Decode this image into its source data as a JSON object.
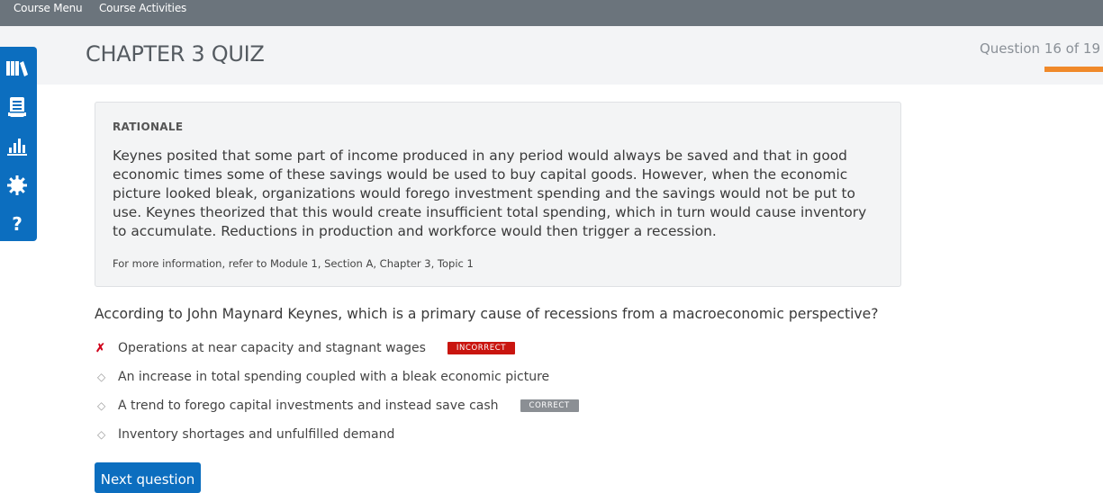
{
  "topbar": {
    "course_menu": "Course Menu",
    "course_activities": "Course Activities"
  },
  "header": {
    "title": "CHAPTER 3 QUIZ",
    "question_counter": "Question 16 of 19"
  },
  "sidenav": {
    "items": [
      "library-icon",
      "notebook-icon",
      "bar-chart-icon",
      "gear-icon",
      "help-icon"
    ]
  },
  "rationale": {
    "heading": "RATIONALE",
    "body": "Keynes posited that some part of income produced in any period would always be saved and that in good economic times some of these savings would be used to buy capital goods. However, when the economic picture looked bleak, organizations would forego investment spending and the savings would not be put to use. Keynes theorized that this would create insufficient total spending, which in turn would cause inventory to accumulate. Reductions in production and workforce would then trigger a recession.",
    "reference": "For more information, refer to Module 1, Section A, Chapter 3, Topic 1"
  },
  "question": {
    "text": "According to John Maynard Keynes, which is a primary cause of recessions from a macroeconomic perspective?",
    "answers": [
      {
        "text": "Operations at near capacity and stagnant wages",
        "marker": "✗",
        "badge": "INCORRECT"
      },
      {
        "text": "An increase in total spending coupled with a bleak economic picture",
        "marker": "◇",
        "badge": ""
      },
      {
        "text": "A trend to forego capital investments and instead save cash",
        "marker": "◇",
        "badge": "CORRECT"
      },
      {
        "text": "Inventory shortages and unfulfilled demand",
        "marker": "◇",
        "badge": ""
      }
    ]
  },
  "next_button": "Next question",
  "colors": {
    "accent": "#0c6ebf",
    "topbar": "#6b747c",
    "progress": "#f0892a",
    "incorrect": "#c9150f",
    "correct": "#8b8f94"
  }
}
